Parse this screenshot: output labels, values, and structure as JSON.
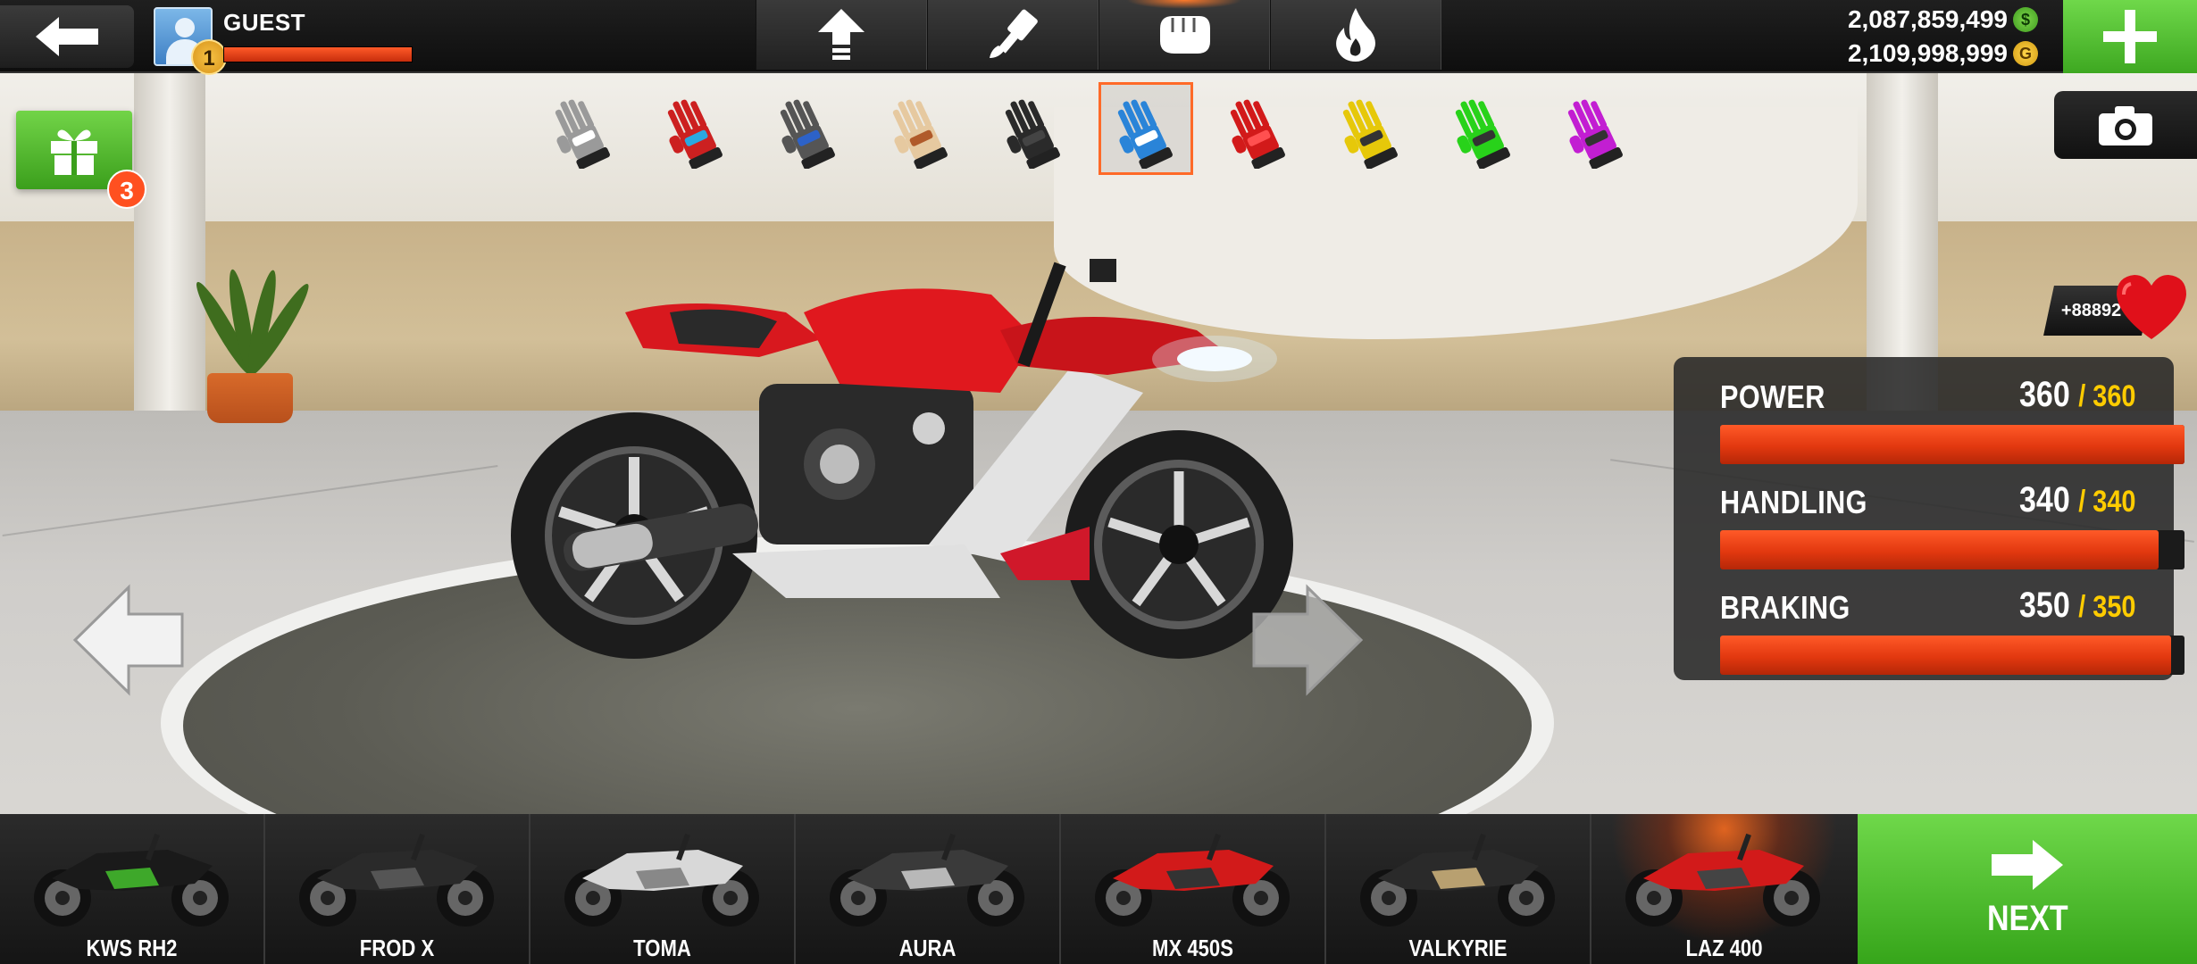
{
  "player": {
    "name": "GUEST",
    "level": "1",
    "xp_progress": 1.0
  },
  "tabs": [
    {
      "icon": "upgrade-arrow-icon",
      "active": false
    },
    {
      "icon": "paint-brush-icon",
      "active": false
    },
    {
      "icon": "glove-icon",
      "active": true
    },
    {
      "icon": "flame-icon",
      "active": false
    }
  ],
  "currency": {
    "cash": "2,087,859,499",
    "gold": "2,109,998,999"
  },
  "gift": {
    "count": "3"
  },
  "gloves": [
    {
      "icon": "glove-icon",
      "color": "#9a9a9a",
      "accent": "#ffffff"
    },
    {
      "icon": "glove-icon",
      "color": "#cc2020",
      "accent": "#2aa8e0"
    },
    {
      "icon": "glove-icon",
      "color": "#555555",
      "accent": "#2d62c8"
    },
    {
      "icon": "glove-icon",
      "color": "#e6c9a0",
      "accent": "#b05a2a"
    },
    {
      "icon": "glove-icon",
      "color": "#2a2a2a",
      "accent": "#444444"
    },
    {
      "icon": "glove-icon",
      "color": "#2a84d8",
      "accent": "#ffffff",
      "selected": true
    },
    {
      "icon": "glove-icon",
      "color": "#d21a1a",
      "accent": "#ff5050"
    },
    {
      "icon": "glove-icon",
      "color": "#e6c80a",
      "accent": "#333333"
    },
    {
      "icon": "glove-icon",
      "color": "#28d21a",
      "accent": "#333333"
    },
    {
      "icon": "glove-icon",
      "color": "#c21ed2",
      "accent": "#333333"
    }
  ],
  "likes": {
    "count": "+88892"
  },
  "stats": [
    {
      "label": "POWER",
      "value": "360",
      "max": "360",
      "fill": 1.0
    },
    {
      "label": "HANDLING",
      "value": "340",
      "max": "340",
      "fill": 0.944
    },
    {
      "label": "BRAKING",
      "value": "350",
      "max": "350",
      "fill": 0.972
    }
  ],
  "bikes": [
    {
      "name": "KWS RH2",
      "color": "#1a1a1a",
      "accent": "#3ea82a",
      "active": false
    },
    {
      "name": "FROD X",
      "color": "#2a2a2a",
      "accent": "#555555",
      "active": false
    },
    {
      "name": "TOMA",
      "color": "#d8d8d8",
      "accent": "#888888",
      "active": false
    },
    {
      "name": "AURA",
      "color": "#3a3a3a",
      "accent": "#b8b8b8",
      "active": false
    },
    {
      "name": "MX 450S",
      "color": "#d21a1a",
      "accent": "#333333",
      "active": false
    },
    {
      "name": "VALKYRIE",
      "color": "#2a2a2a",
      "accent": "#b8a070",
      "active": false
    },
    {
      "name": "LAZ 400",
      "color": "#d21a1a",
      "accent": "#444444",
      "active": true
    }
  ],
  "next_button": {
    "label": "NEXT"
  },
  "colors": {
    "accent_orange": "#ff5a28",
    "accent_green": "#4cbf2a",
    "stat_max_yellow": "#ffcc00"
  }
}
